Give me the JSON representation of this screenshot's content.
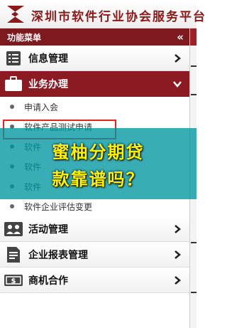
{
  "header": {
    "title": "深圳市软件行业协会服务平台"
  },
  "sidebar": {
    "header_title": "功能菜单",
    "collapse_label": "«",
    "menu": [
      {
        "label": "信息管理",
        "icon": "info-list-icon"
      },
      {
        "label": "业务办理",
        "icon": "briefcase-icon"
      },
      {
        "label": "活动管理",
        "icon": "people-icon"
      },
      {
        "label": "企业报表管理",
        "icon": "report-icon"
      },
      {
        "label": "商机合作",
        "icon": "money-icon"
      }
    ],
    "sub_items": [
      "申请入会",
      "软件产品测试申请",
      "软件",
      "软件",
      "软件",
      "软件企业评估变更"
    ]
  },
  "overlay": {
    "line1": "蜜柚分期贷",
    "line2": "款靠谱吗？"
  },
  "colors": {
    "brand": "#8b1a22",
    "overlay": "#0096a0",
    "overlay_text": "#fff200",
    "highlight": "#e52222"
  }
}
